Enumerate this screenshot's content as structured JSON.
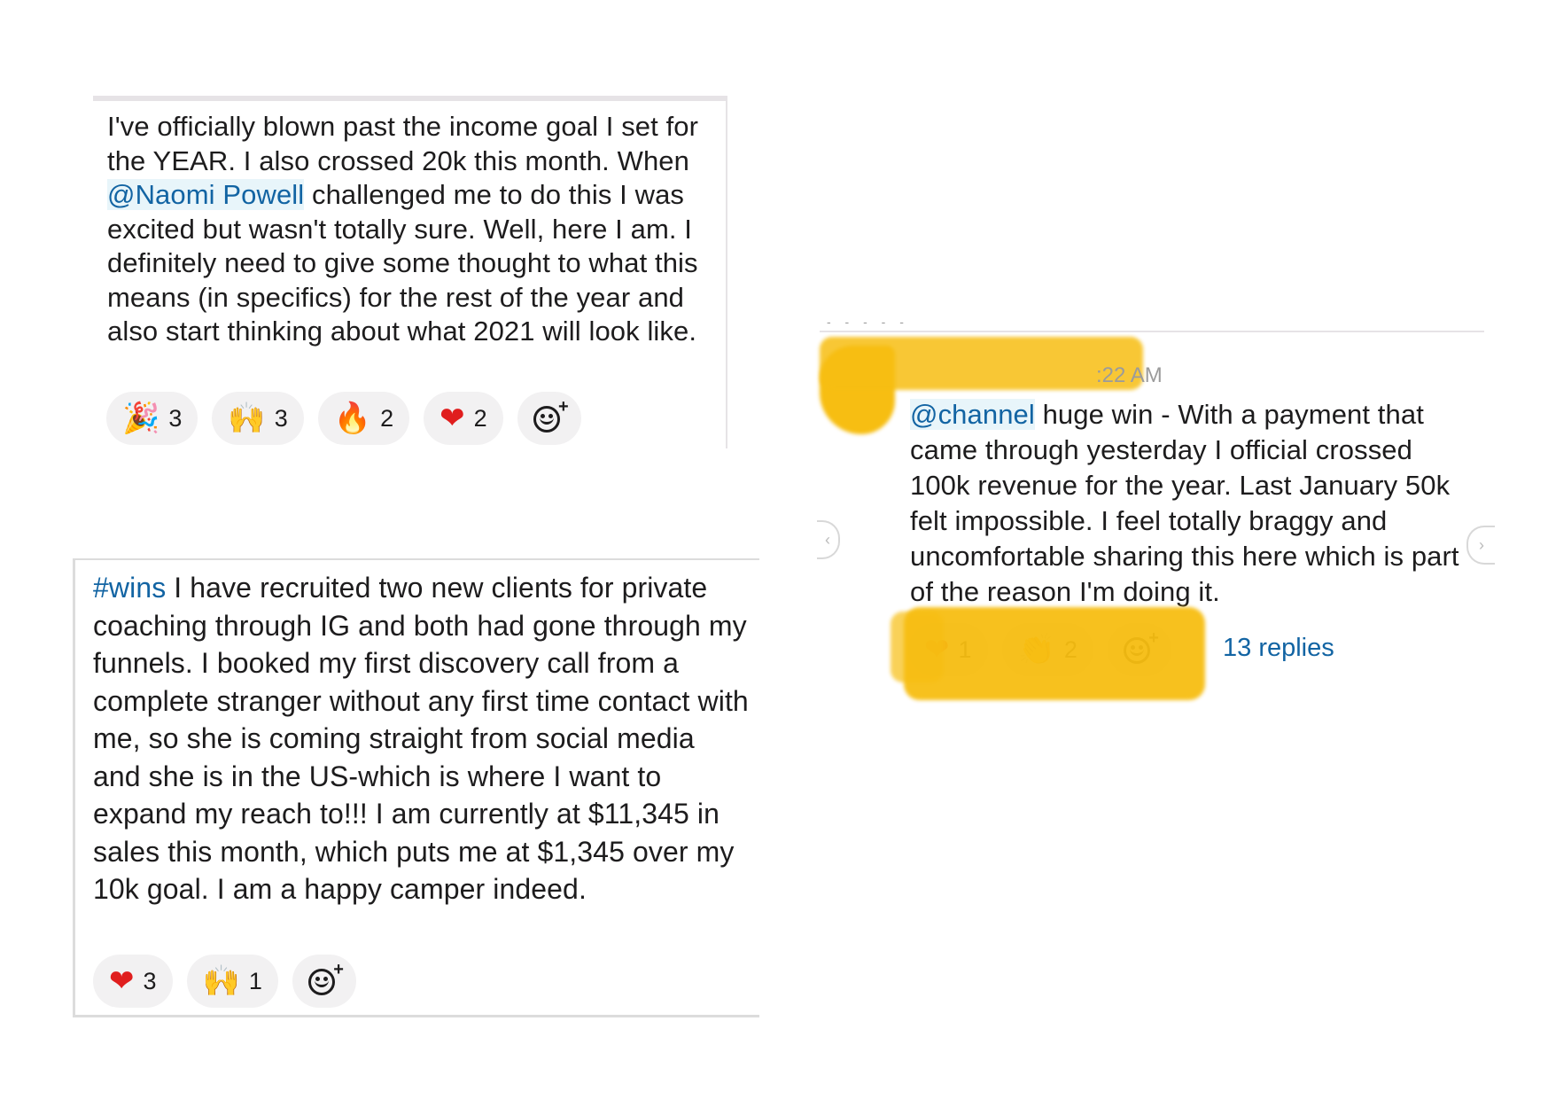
{
  "post1": {
    "mention": "@Naomi Powell",
    "text_before": "I've officially blown past the income goal I set for the YEAR. I also crossed 20k this month. When ",
    "text_after": " challenged me to do this I was excited but wasn't totally sure. Well, here I am. I definitely need to give some thought to what this means (in specifics) for the rest of the year and also start thinking about what 2021 will look like.",
    "reactions": [
      {
        "icon": "party-popper-icon",
        "glyph": "🎉",
        "count": "3"
      },
      {
        "icon": "raised-hands-icon",
        "glyph": "🙌",
        "count": "3"
      },
      {
        "icon": "fire-icon",
        "glyph": "🔥",
        "count": "2"
      },
      {
        "icon": "heart-icon",
        "glyph": "❤",
        "count": "2"
      }
    ]
  },
  "post2": {
    "hashtag": "#wins",
    "text": " I have recruited two new clients for private coaching through IG and both had gone through my funnels. I booked my first discovery call from a complete stranger without any first time contact with me, so she is coming straight from social media and she is in the US-which is where I want to expand my reach to!!! I am currently at $11,345 in sales this month, which puts me at $1,345 over my 10k goal. I am a happy camper indeed.",
    "reactions": [
      {
        "icon": "heart-icon",
        "glyph": "❤",
        "count": "3"
      },
      {
        "icon": "raised-hands-icon",
        "glyph": "🙌",
        "count": "1"
      }
    ]
  },
  "post3": {
    "timestamp": ":22 AM",
    "mention": "@channel",
    "text": " huge win - With a payment that came through yesterday I official crossed 100k revenue for the year. Last January 50k felt impossible. I feel totally braggy and uncomfortable sharing this here which is part of the reason I'm doing it.",
    "reactions": [
      {
        "icon": "heart-icon",
        "glyph": "❤",
        "count": "1"
      },
      {
        "icon": "clapping-hands-icon",
        "glyph": "👏",
        "count": "2"
      }
    ],
    "replies": "13 replies"
  },
  "colors": {
    "link": "#1264a3",
    "redaction": "#f7be12",
    "pill": "#f2f1f2",
    "heart": "#e01e1e"
  }
}
